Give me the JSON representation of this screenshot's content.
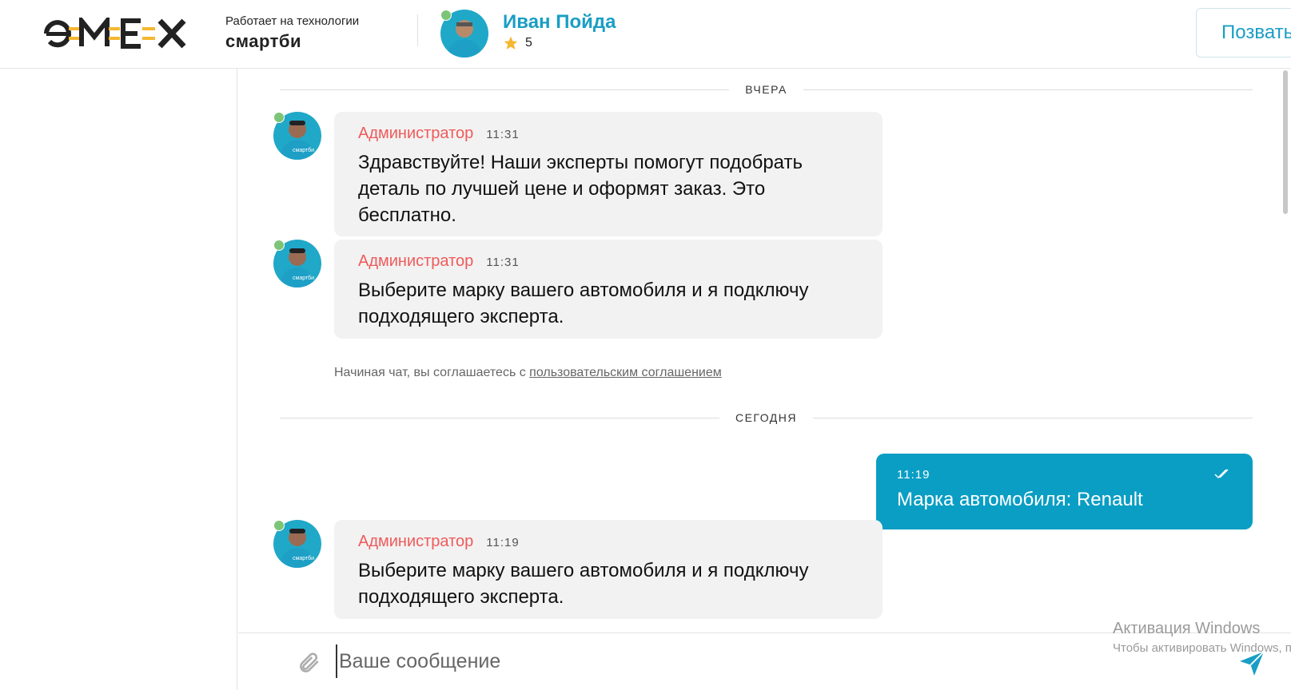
{
  "header": {
    "logo": "e-MEX",
    "powered_by": "Работает на технологии",
    "brand": "смартби",
    "expert_name": "Иван Пойда",
    "expert_rating": "5",
    "call_label": "Позвать"
  },
  "chat": {
    "sep_yesterday": "ВЧЕРА",
    "sep_today": "СЕГОДНЯ",
    "messages": [
      {
        "author": "Администратор",
        "time": "11:31",
        "text": "Здравствуйте! Наши эксперты помогут подобрать деталь по лучшей цене и оформят заказ. Это бесплатно."
      },
      {
        "author": "Администратор",
        "time": "11:31",
        "text": "Выберите марку вашего автомобиля и я подключу подходящего эксперта."
      },
      {
        "author": "Администратор",
        "time": "11:19",
        "text": "Выберите марку вашего автомобиля и я подключу подходящего эксперта."
      }
    ],
    "consent_prefix": "Начиная чат, вы соглашаетесь с",
    "consent_link": "пользовательским соглашением",
    "outgoing": {
      "time": "11:19",
      "text": "Марка автомобиля: Renault"
    },
    "avatar_caption": "смартби"
  },
  "composer": {
    "placeholder": "Ваше сообщение"
  },
  "watermark": {
    "line1": "Активация Windows",
    "line2": "Чтобы активировать Windows, п"
  },
  "colors": {
    "accent": "#0a9ec4",
    "author": "#f05a5a",
    "online": "#7cc576",
    "bubble": "#f2f2f2"
  },
  "icons": [
    "star-icon",
    "paperclip-icon",
    "send-icon",
    "double-check-icon"
  ]
}
